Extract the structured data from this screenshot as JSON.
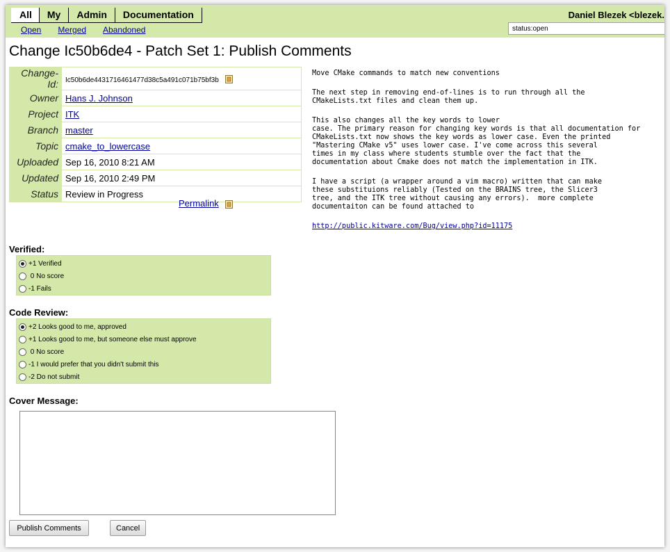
{
  "nav": {
    "tabs": [
      {
        "label": "All",
        "active": true
      },
      {
        "label": "My",
        "active": false
      },
      {
        "label": "Admin",
        "active": false
      },
      {
        "label": "Documentation",
        "active": false
      }
    ],
    "subtabs": [
      "Open",
      "Merged",
      "Abandoned"
    ],
    "user": "Daniel Blezek <blezek.",
    "search_value": "status:open"
  },
  "title": "Change Ic50b6de4 - Patch Set 1: Publish Comments",
  "info": {
    "change_id_label": "Change-Id:",
    "change_id": "Ic50b6de4431716461477d38c5a491c071b75bf3b",
    "owner_label": "Owner",
    "owner": "Hans J. Johnson",
    "project_label": "Project",
    "project": "ITK",
    "branch_label": "Branch",
    "branch": "master",
    "topic_label": "Topic",
    "topic": "cmake_to_lowercase",
    "uploaded_label": "Uploaded",
    "uploaded": "Sep 16, 2010 8:21 AM",
    "updated_label": "Updated",
    "updated": "Sep 16, 2010 2:49 PM",
    "status_label": "Status",
    "status": "Review in Progress",
    "permalink": "Permalink"
  },
  "commit_message": {
    "p1": "Move CMake commands to match new conventions",
    "p2": "The next step in removing end-of-lines is to run through all the\nCMakeLists.txt files and clean them up.",
    "p3": "This also changes all the key words to lower\ncase. The primary reason for changing key words is that all documentation for\nCMakeLists.txt now shows the key words as lower case. Even the printed\n\"Mastering CMake v5\" uses lower case. I've come across this several\ntimes in my class where students stumble over the fact that the\ndocumentation about Cmake does not match the implementation in ITK.",
    "p4": "I have a script (a wrapper around a vim macro) written that can make\nthese substituions reliably (Tested on the BRAINS tree, the Slicer3\ntree, and the ITK tree without causing any errors).  more complete\ndocumentaiton can be found attached to",
    "link": "http://public.kitware.com/Bug/view.php?id=11175"
  },
  "verified": {
    "label": "Verified:",
    "options": [
      {
        "label": "+1 Verified",
        "checked": true
      },
      {
        "label": " 0 No score",
        "checked": false
      },
      {
        "label": "-1 Fails",
        "checked": false
      }
    ]
  },
  "code_review": {
    "label": "Code Review:",
    "options": [
      {
        "label": "+2 Looks good to me, approved",
        "checked": true
      },
      {
        "label": "+1 Looks good to me, but someone else must approve",
        "checked": false
      },
      {
        "label": " 0 No score",
        "checked": false
      },
      {
        "label": "-1 I would prefer that you didn't submit this",
        "checked": false
      },
      {
        "label": "-2 Do not submit",
        "checked": false
      }
    ]
  },
  "cover": {
    "label": "Cover Message:",
    "value": ""
  },
  "buttons": {
    "publish": "Publish Comments",
    "cancel": "Cancel"
  },
  "colors": {
    "header_bg": "#d4e9a9",
    "link": "#00009c"
  }
}
